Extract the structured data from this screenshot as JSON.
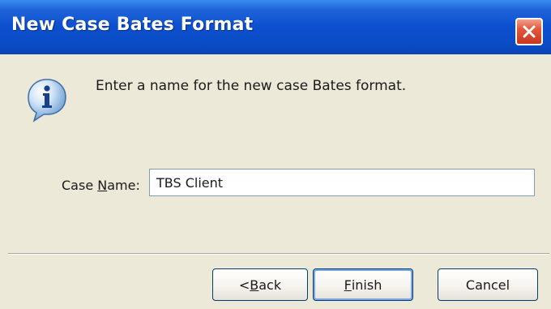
{
  "window": {
    "title": "New Case Bates Format"
  },
  "message": {
    "text": "Enter a name for the new case Bates format."
  },
  "case_name": {
    "label_prefix": "Case ",
    "label_underlined": "N",
    "label_suffix": "ame:",
    "value": "TBS Client"
  },
  "buttons": {
    "back": {
      "prefix": "< ",
      "underlined": "B",
      "suffix": "ack"
    },
    "finish": {
      "prefix": "",
      "underlined": "F",
      "suffix": "inish"
    },
    "cancel": {
      "label": "Cancel"
    }
  },
  "icons": {
    "info": "info-icon",
    "close": "close-icon"
  },
  "colors": {
    "titlebar": "#0c4fcf",
    "close_button": "#e2573b",
    "dialog_background": "#ece9d8",
    "button_border": "#003c74"
  }
}
